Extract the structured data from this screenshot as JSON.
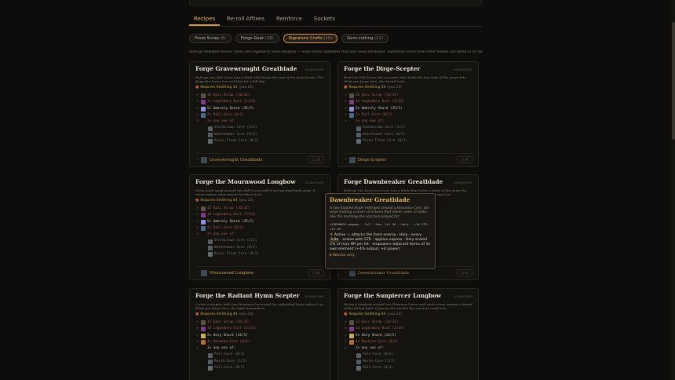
{
  "tabs": [
    {
      "label": "Recipes",
      "active": true
    },
    {
      "label": "Re-roll Affixes",
      "active": false
    },
    {
      "label": "Reinforce",
      "active": false
    },
    {
      "label": "Sockets",
      "active": false
    }
  ],
  "chips": [
    {
      "label": "Press Scrap",
      "count": "(6)",
      "active": false
    },
    {
      "label": "Forge Gear",
      "count": "(38)",
      "active": false
    },
    {
      "label": "Signature Crafts",
      "count": "(16)",
      "active": true
    },
    {
      "label": "Gem-cutting",
      "count": "(21)",
      "active": false
    }
  ],
  "subtitle": "Reforge defeated bosses' items into legendary class weapons — keep-hoard capstones that take deep stockpiles. Substitute cores from other bosses can stand in for part of the bill.",
  "cards": [
    {
      "title": "Forge Gravewrought Greatblade",
      "tag": "SIGNATURE",
      "desc": "Reforge two Pall-Cores into a blade that keeps the rest of the deep tombs. The forge fire burns low and blue for a full day.",
      "req_label": "Requires Smithing 44",
      "req_have": "(you 23)",
      "rows": [
        {
          "mark": "×",
          "status": "bad",
          "icon": "scrap",
          "text": "32 Epic Scrap (18/32)"
        },
        {
          "mark": "×",
          "status": "bad",
          "icon": "dust",
          "text": "2× Legendary Dust (1/14)"
        },
        {
          "mark": "✓",
          "status": "ok",
          "icon": "shard",
          "text": "5× Umbraly Shard (35/5)"
        },
        {
          "mark": "×",
          "status": "bad",
          "icon": "core",
          "text": "2× Pall-Core (0/2)"
        },
        {
          "mark": "×",
          "status": "bad",
          "icon": "",
          "text": "2× any one of:"
        },
        {
          "mark": "",
          "status": "sub",
          "icon": "storm",
          "text": "Stormcrown Core (1/2)"
        },
        {
          "mark": "",
          "status": "sub",
          "icon": "watch",
          "text": "Watchtower Core (0/2)"
        },
        {
          "mark": "",
          "status": "sub",
          "icon": "riven",
          "text": "Riven Titan Core (0/2)"
        }
      ],
      "result": "Gravewrought Greatblade",
      "craft_label": "Craft"
    },
    {
      "title": "Forge the Dirge-Scepter",
      "tag": "SIGNATURE",
      "desc": "Bind two Pall-Cores into a scepter that holds the low note of the grave-tide. What you forge here, the buried hear.",
      "req_label": "Requires Smithing 44",
      "req_have": "(you 23)",
      "rows": [
        {
          "mark": "×",
          "status": "bad",
          "icon": "scrap",
          "text": "32 Epic Scrap (14/32)"
        },
        {
          "mark": "×",
          "status": "bad",
          "icon": "dust",
          "text": "14 Legendary Dust (3/14)"
        },
        {
          "mark": "✓",
          "status": "ok",
          "icon": "shard",
          "text": "5× Umbraly Shard (35/5)"
        },
        {
          "mark": "×",
          "status": "bad",
          "icon": "core",
          "text": "2× Pall-Core (0/2)"
        },
        {
          "mark": "×",
          "status": "bad",
          "icon": "",
          "text": "2× any one of:"
        },
        {
          "mark": "",
          "status": "sub",
          "icon": "storm",
          "text": "Stormcrown Core (1/2)"
        },
        {
          "mark": "",
          "status": "sub",
          "icon": "watch",
          "text": "Watchtower Core (0/2)"
        },
        {
          "mark": "",
          "status": "sub",
          "icon": "riven",
          "text": "Riven Titan Core (0/2)"
        }
      ],
      "result": "Dirge-Scepter",
      "craft_label": "Craft"
    },
    {
      "title": "Forge the Mournwood Longbow",
      "tag": "SIGNATURE",
      "desc": "Grow tomb-wood around two Pall-Cores until it strings itself with grief. It never misses what cannot be taken back.",
      "req_label": "Requires Smithing 44",
      "req_have": "(you 23)",
      "rows": [
        {
          "mark": "×",
          "status": "bad",
          "icon": "scrap",
          "text": "32 Epic Scrap (16/32)"
        },
        {
          "mark": "×",
          "status": "bad",
          "icon": "dust",
          "text": "14 Legendary Dust (3/14)"
        },
        {
          "mark": "✓",
          "status": "ok",
          "icon": "shard",
          "text": "5× Umbraly Shard (35/5)"
        },
        {
          "mark": "×",
          "status": "bad",
          "icon": "core",
          "text": "2× Pall-Core (0/2)"
        },
        {
          "mark": "×",
          "status": "bad",
          "icon": "",
          "text": "2× any one of:"
        },
        {
          "mark": "",
          "status": "sub",
          "icon": "storm",
          "text": "Stormcrown Core (1/2)"
        },
        {
          "mark": "",
          "status": "sub",
          "icon": "watch",
          "text": "Watchtower Core (0/2)"
        },
        {
          "mark": "",
          "status": "sub",
          "icon": "riven",
          "text": "Riven Titan Core (0/2)"
        }
      ],
      "result": "Mournwood Longbow",
      "craft_label": "Craft"
    },
    {
      "title": "Forge Dawnbreaker Greatblade",
      "tag": "SIGNATURE",
      "desc": "Reforge two Hosanna-Cores into a blade that holds a sliver of the dawn the sun never came. It looks like the morning the sanctum prayed for.",
      "req_label": "Requires Smithing 44",
      "req_have": "(you 23)",
      "rows": [],
      "result": "Dawnbreaker Greatblade",
      "craft_label": "Craft"
    },
    {
      "title": "Forge the Radiant Hymn Scepter",
      "tag": "SIGNATURE",
      "desc": "Crown a scepter with two Hosanna-Cores and the unfinished hymn takes it up. What you forge here, the light remembers.",
      "req_label": "Requires Smithing 44",
      "req_have": "(you 23)",
      "rows": [
        {
          "mark": "×",
          "status": "bad",
          "icon": "scrap",
          "text": "32 Epic Scrap (16/32)"
        },
        {
          "mark": "×",
          "status": "bad",
          "icon": "dust",
          "text": "14 Legendary Dust (3/14)"
        },
        {
          "mark": "✓",
          "status": "ok",
          "icon": "holy",
          "text": "5× Holy Shard (16/5)"
        },
        {
          "mark": "×",
          "status": "bad",
          "icon": "core2",
          "text": "4× Hosanna-Core (0/4)"
        },
        {
          "mark": "✓",
          "status": "ok",
          "icon": "",
          "text": "3× any one of:"
        },
        {
          "mark": "",
          "status": "sub",
          "icon": "storm",
          "text": "Pall-Core (0/3)"
        },
        {
          "mark": "",
          "status": "sub",
          "icon": "watch",
          "text": "Marsh-Core (1/3)"
        },
        {
          "mark": "",
          "status": "sub",
          "icon": "riven",
          "text": "Pall-Core (0/3)"
        }
      ],
      "result": "",
      "craft_label": ""
    },
    {
      "title": "Forge the Sunpiercer Longbow",
      "tag": "SIGNATURE",
      "desc": "String a longbow around two Hosanna-Cores until each arrow carries a thread of the falling light. It passes the verdict the sanctum could not.",
      "req_label": "Requires Smithing 44",
      "req_have": "(you 23)",
      "rows": [
        {
          "mark": "×",
          "status": "bad",
          "icon": "scrap",
          "text": "32 Epic Scrap (14/32)"
        },
        {
          "mark": "×",
          "status": "bad",
          "icon": "dust",
          "text": "14 Legendary Dust (3/14)"
        },
        {
          "mark": "✓",
          "status": "ok",
          "icon": "holy",
          "text": "5× Holy Shard (24/5)"
        },
        {
          "mark": "×",
          "status": "bad",
          "icon": "core2",
          "text": "4× Hosanna-Core (0/4)"
        },
        {
          "mark": "✓",
          "status": "ok",
          "icon": "",
          "text": "3× any one of:"
        },
        {
          "mark": "",
          "status": "sub",
          "icon": "storm",
          "text": "Pall-Core (0/3)"
        },
        {
          "mark": "",
          "status": "sub",
          "icon": "watch",
          "text": "Marsh-Core (1/3)"
        },
        {
          "mark": "",
          "status": "sub",
          "icon": "riven",
          "text": "Pall-Core (0/3)"
        }
      ],
      "result": "",
      "craft_label": ""
    }
  ],
  "tooltip": {
    "title": "Dawnbreaker Greatblade",
    "desc": "A two-handed blade reforged around a Hosanna-Core, the edge holding a sliver of a dawn that never came. It looks like the morning the sanctum prayed for.",
    "stats": "LEGENDARY weapon · 2×2 · Req. Int 36 · Holy · +16 STR, +14 HP",
    "effect_active": "Active",
    "effect_text": "— attacks the front enemy · Holy · every",
    "effect_cd": "3.0s",
    "effect_text2": "· scales with STR ·",
    "effect_expose": "applies expose",
    "effect_text3": "· Holy-scaled 2% of max HP per hit · empowers adjacent items of its own element (+4% output, +4 power)",
    "class_label": "Warrior only"
  }
}
